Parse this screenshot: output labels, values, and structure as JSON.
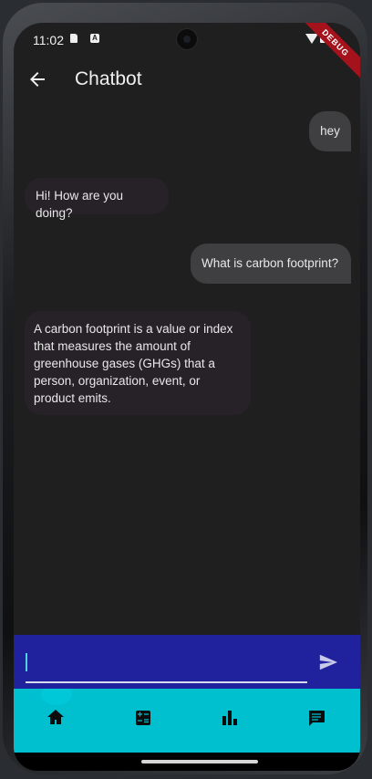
{
  "status_bar": {
    "time": "11:02",
    "debug_banner": "DEBUG"
  },
  "appbar": {
    "title": "Chatbot",
    "back_icon": "arrow-left-icon"
  },
  "messages": [
    {
      "sender": "user",
      "text": "hey"
    },
    {
      "sender": "bot",
      "text": "Hi! How are you doing?"
    },
    {
      "sender": "user",
      "text": "What is carbon footprint?"
    },
    {
      "sender": "bot",
      "text": "A carbon footprint is a value or index that measures the amount of greenhouse gases (GHGs) that a person, organization, event, or product emits."
    }
  ],
  "input": {
    "value": "",
    "placeholder": ""
  },
  "bottom_nav": {
    "items": [
      {
        "icon": "home-icon",
        "selected": true
      },
      {
        "icon": "calculator-icon",
        "selected": false
      },
      {
        "icon": "bar-chart-icon",
        "selected": false
      },
      {
        "icon": "chat-icon",
        "selected": false
      }
    ]
  },
  "colors": {
    "screen_bg": "#1f1f1f",
    "user_bubble": "#3f3f41",
    "bot_bubble": "#272228",
    "input_bar": "#1f229c",
    "nav_bar": "#00bfcf"
  }
}
